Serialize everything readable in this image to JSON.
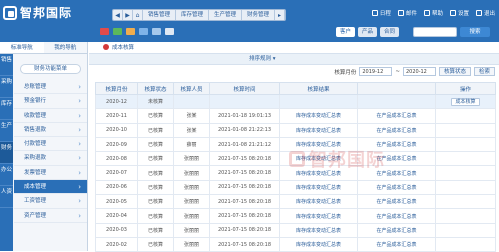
{
  "app": {
    "logo_text": "智邦国际"
  },
  "topnav": {
    "breadcrumbs": [
      "销售管理",
      "库存管理",
      "生产管理",
      "财务管理"
    ]
  },
  "header_links": [
    "日程",
    "邮件",
    "帮助",
    "设置",
    "退出"
  ],
  "quick": {
    "tabs": [
      "客户",
      "产品",
      "合同"
    ],
    "search_button": "搜索"
  },
  "sidebar": {
    "tabs": [
      "标准导航",
      "我的导航"
    ],
    "vertical_tabs": [
      "销售",
      "采购",
      "库存",
      "生产",
      "财务",
      "办公",
      "人资"
    ],
    "fav_button": "财务功能菜单",
    "items": [
      "总账管理",
      "预金银行",
      "收款管理",
      "销售退款",
      "付款管理",
      "采购退款",
      "发票管理",
      "成本管理",
      "工资管理",
      "资产管理"
    ]
  },
  "main": {
    "title": "成本核算",
    "sub_title": "排序规则",
    "filters": {
      "label": "核算月份",
      "from": "2019-12",
      "sep": "~",
      "to": "2020-12",
      "status_button": "核算状态",
      "search_button": "检索"
    },
    "columns": [
      "核算月份",
      "核算状态",
      "核算人员",
      "核算时间",
      "核算结果",
      "",
      "操作"
    ],
    "rows": [
      {
        "month": "2020-12",
        "status": "未核算",
        "person": "",
        "time": "",
        "result1": "",
        "result2": "",
        "op": "成本核算"
      },
      {
        "month": "2020-11",
        "status": "已核算",
        "person": "张某",
        "time": "2021-01-18 19:01:13",
        "result1": "库存成本变动汇总表",
        "result2": "在产品成本汇总表",
        "op": ""
      },
      {
        "month": "2020-10",
        "status": "已核算",
        "person": "张某",
        "time": "2021-01-08 21:22:13",
        "result1": "库存成本变动汇总表",
        "result2": "在产品成本汇总表",
        "op": ""
      },
      {
        "month": "2020-09",
        "status": "已核算",
        "person": "薛丽",
        "time": "2021-01-08 21:21:12",
        "result1": "库存成本变动汇总表",
        "result2": "在产品成本汇总表",
        "op": ""
      },
      {
        "month": "2020-08",
        "status": "已核算",
        "person": "张丽丽",
        "time": "2021-07-15 08:20:18",
        "result1": "库存成本变动汇总表",
        "result2": "在产品成本汇总表",
        "op": ""
      },
      {
        "month": "2020-07",
        "status": "已核算",
        "person": "张丽丽",
        "time": "2021-07-15 08:20:18",
        "result1": "库存成本变动汇总表",
        "result2": "在产品成本汇总表",
        "op": ""
      },
      {
        "month": "2020-06",
        "status": "已核算",
        "person": "张丽丽",
        "time": "2021-07-15 08:20:18",
        "result1": "库存成本变动汇总表",
        "result2": "在产品成本汇总表",
        "op": ""
      },
      {
        "month": "2020-05",
        "status": "已核算",
        "person": "张丽丽",
        "time": "2021-07-15 08:20:18",
        "result1": "库存成本变动汇总表",
        "result2": "在产品成本汇总表",
        "op": ""
      },
      {
        "month": "2020-04",
        "status": "已核算",
        "person": "张丽丽",
        "time": "2021-07-15 08:20:18",
        "result1": "库存成本变动汇总表",
        "result2": "在产品成本汇总表",
        "op": ""
      },
      {
        "month": "2020-03",
        "status": "已核算",
        "person": "张丽丽",
        "time": "2021-07-15 08:20:18",
        "result1": "库存成本变动汇总表",
        "result2": "在产品成本汇总表",
        "op": ""
      },
      {
        "month": "2020-02",
        "status": "已核算",
        "person": "张丽丽",
        "time": "2021-07-15 08:20:18",
        "result1": "库存成本变动汇总表",
        "result2": "在产品成本汇总表",
        "op": ""
      }
    ]
  },
  "watermark": "智邦国际",
  "colors": {
    "brand": "#2a6fb7",
    "accent": "#d23a3a"
  }
}
